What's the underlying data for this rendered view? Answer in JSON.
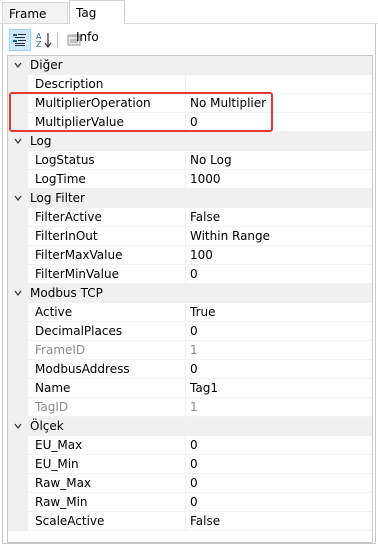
{
  "tabs": [
    {
      "label": "Frame Info"
    },
    {
      "label": "Tag Info"
    }
  ],
  "toolbar": {
    "icons": [
      "categorized-icon",
      "alphabetical-icon",
      "property-pages-icon"
    ]
  },
  "highlight_color": "#e53935",
  "categories": [
    {
      "label": "Diğer",
      "props": [
        {
          "name": "Description",
          "value": "",
          "readonly": false
        },
        {
          "name": "MultiplierOperation",
          "value": "No Multiplier",
          "readonly": false
        },
        {
          "name": "MultiplierValue",
          "value": "0",
          "readonly": false
        }
      ]
    },
    {
      "label": "Log",
      "props": [
        {
          "name": "LogStatus",
          "value": "No Log",
          "readonly": false
        },
        {
          "name": "LogTime",
          "value": "1000",
          "readonly": false
        }
      ]
    },
    {
      "label": "Log Filter",
      "props": [
        {
          "name": "FilterActive",
          "value": "False",
          "readonly": false
        },
        {
          "name": "FilterInOut",
          "value": "Within Range",
          "readonly": false
        },
        {
          "name": "FilterMaxValue",
          "value": "100",
          "readonly": false
        },
        {
          "name": "FilterMinValue",
          "value": "0",
          "readonly": false
        }
      ]
    },
    {
      "label": "Modbus TCP",
      "props": [
        {
          "name": "Active",
          "value": "True",
          "readonly": false
        },
        {
          "name": "DecimalPlaces",
          "value": "0",
          "readonly": false
        },
        {
          "name": "FrameID",
          "value": "1",
          "readonly": true
        },
        {
          "name": "ModbusAddress",
          "value": "0",
          "readonly": false
        },
        {
          "name": "Name",
          "value": "Tag1",
          "readonly": false
        },
        {
          "name": "TagID",
          "value": "1",
          "readonly": true
        }
      ]
    },
    {
      "label": "Ölçek",
      "props": [
        {
          "name": "EU_Max",
          "value": "0",
          "readonly": false
        },
        {
          "name": "EU_Min",
          "value": "0",
          "readonly": false
        },
        {
          "name": "Raw_Max",
          "value": "0",
          "readonly": false
        },
        {
          "name": "Raw_Min",
          "value": "0",
          "readonly": false
        },
        {
          "name": "ScaleActive",
          "value": "False",
          "readonly": false
        }
      ]
    }
  ]
}
